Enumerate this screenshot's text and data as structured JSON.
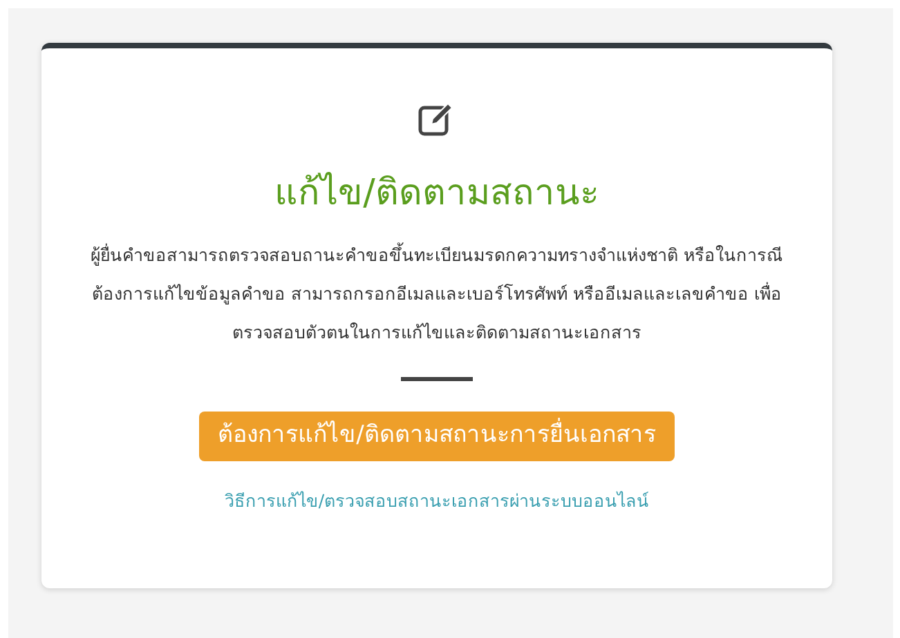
{
  "card": {
    "title": "แก้ไข/ติดตามสถานะ",
    "description": "ผู้ยื่นคำขอสามารถตรวจสอบถานะคำขอขึ้นทะเบียนมรดกความทรางจำแห่งชาติ หรือในการณีต้องการแก้ไขข้อมูลคำขอ สามารถกรอกอีเมลและเบอร์โทรศัพท์ หรืออีเมลและเลขคำขอ เพื่อตรวจสอบตัวตนในการแก้ไขและติดตามสถานะเอกสาร",
    "button": "ต้องการแก้ไข/ติดตามสถานะการยื่นเอกสาร",
    "link": "วิธีการแก้ไข/ตรวจสอบสถานะเอกสารผ่านระบบออนไลน์"
  }
}
